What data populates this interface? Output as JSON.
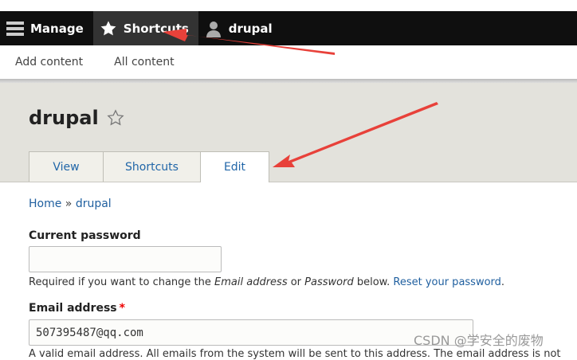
{
  "toolbar": {
    "manage_label": "Manage",
    "shortcuts_label": "Shortcuts",
    "user_label": "drupal"
  },
  "tray": {
    "add_content": "Add content",
    "all_content": "All content"
  },
  "page": {
    "title": "drupal",
    "tabs": [
      "View",
      "Shortcuts",
      "Edit"
    ]
  },
  "breadcrumb": {
    "home": "Home",
    "sep": " » ",
    "current": "drupal"
  },
  "form": {
    "current_password_label": "Current password",
    "current_password_value": "",
    "current_password_desc_1": "Required if you want to change the ",
    "current_password_desc_em1": "Email address",
    "current_password_desc_2": " or ",
    "current_password_desc_em2": "Password",
    "current_password_desc_3": " below. ",
    "reset_link": "Reset your password",
    "reset_after": ".",
    "email_label": "Email address",
    "email_required_mark": "*",
    "email_value": "507395487@qq.com",
    "email_desc": "A valid email address. All emails from the system will be sent to this address. The email address is not"
  },
  "watermark": "CSDN @学安全的废物",
  "colors": {
    "toolbar_bg": "#0f0f0f",
    "active_tab_bg": "#333333",
    "link": "#1f5f9f",
    "annotation_arrow": "#e8413a"
  }
}
